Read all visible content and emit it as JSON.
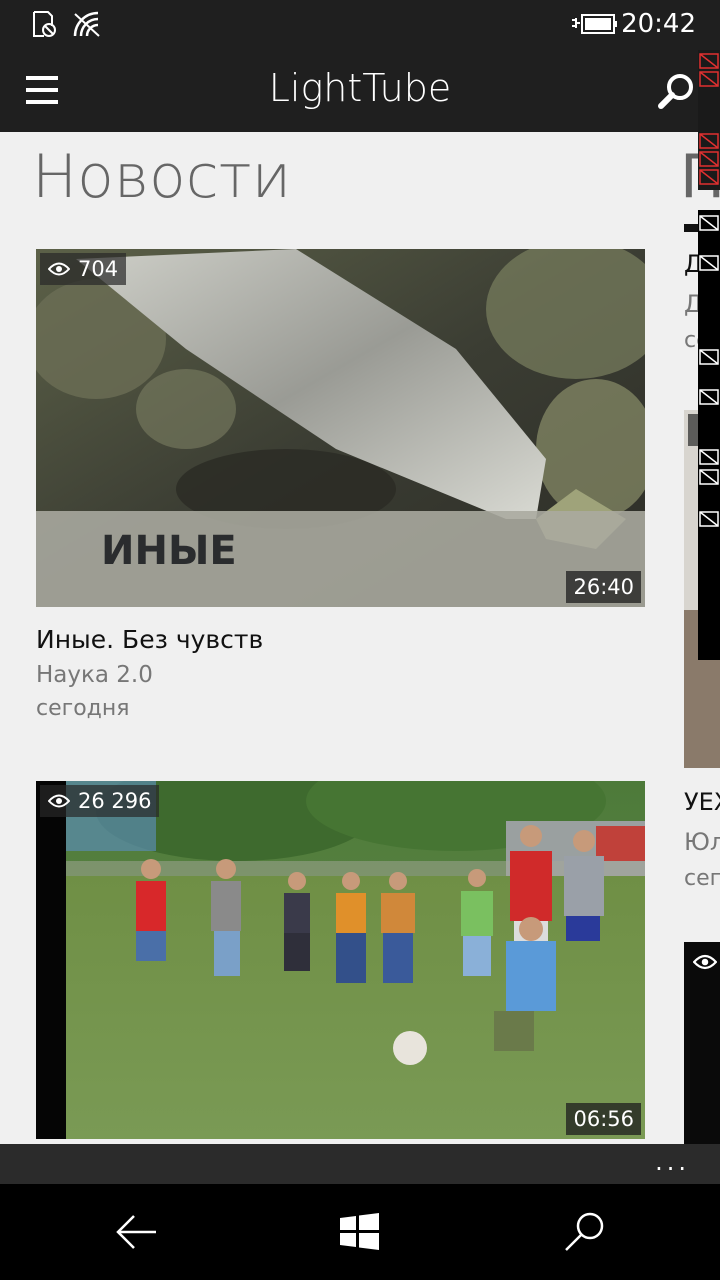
{
  "status_bar": {
    "time": "20:42"
  },
  "app_bar": {
    "title": "LightTube"
  },
  "section": {
    "title": "Новости",
    "next_title": "П"
  },
  "videos": [
    {
      "views": "704",
      "duration": "26:40",
      "title": "Иные. Без чувств",
      "channel": "Наука 2.0",
      "date": "сегодня",
      "overlay_text": "ИНЫЕ"
    },
    {
      "views": "26 296",
      "duration": "06:56"
    }
  ],
  "peek": {
    "item1": {
      "title": "Д",
      "channel": "Д",
      "date": "сег"
    },
    "item2": {
      "title": "УЕХ",
      "channel": "Юл",
      "date": "сег"
    }
  },
  "command_bar": {
    "more": "..."
  },
  "colors": {
    "bar": "#1f1f1f",
    "content_bg": "#f0f0f0",
    "command_bar": "#2b2b2b"
  }
}
